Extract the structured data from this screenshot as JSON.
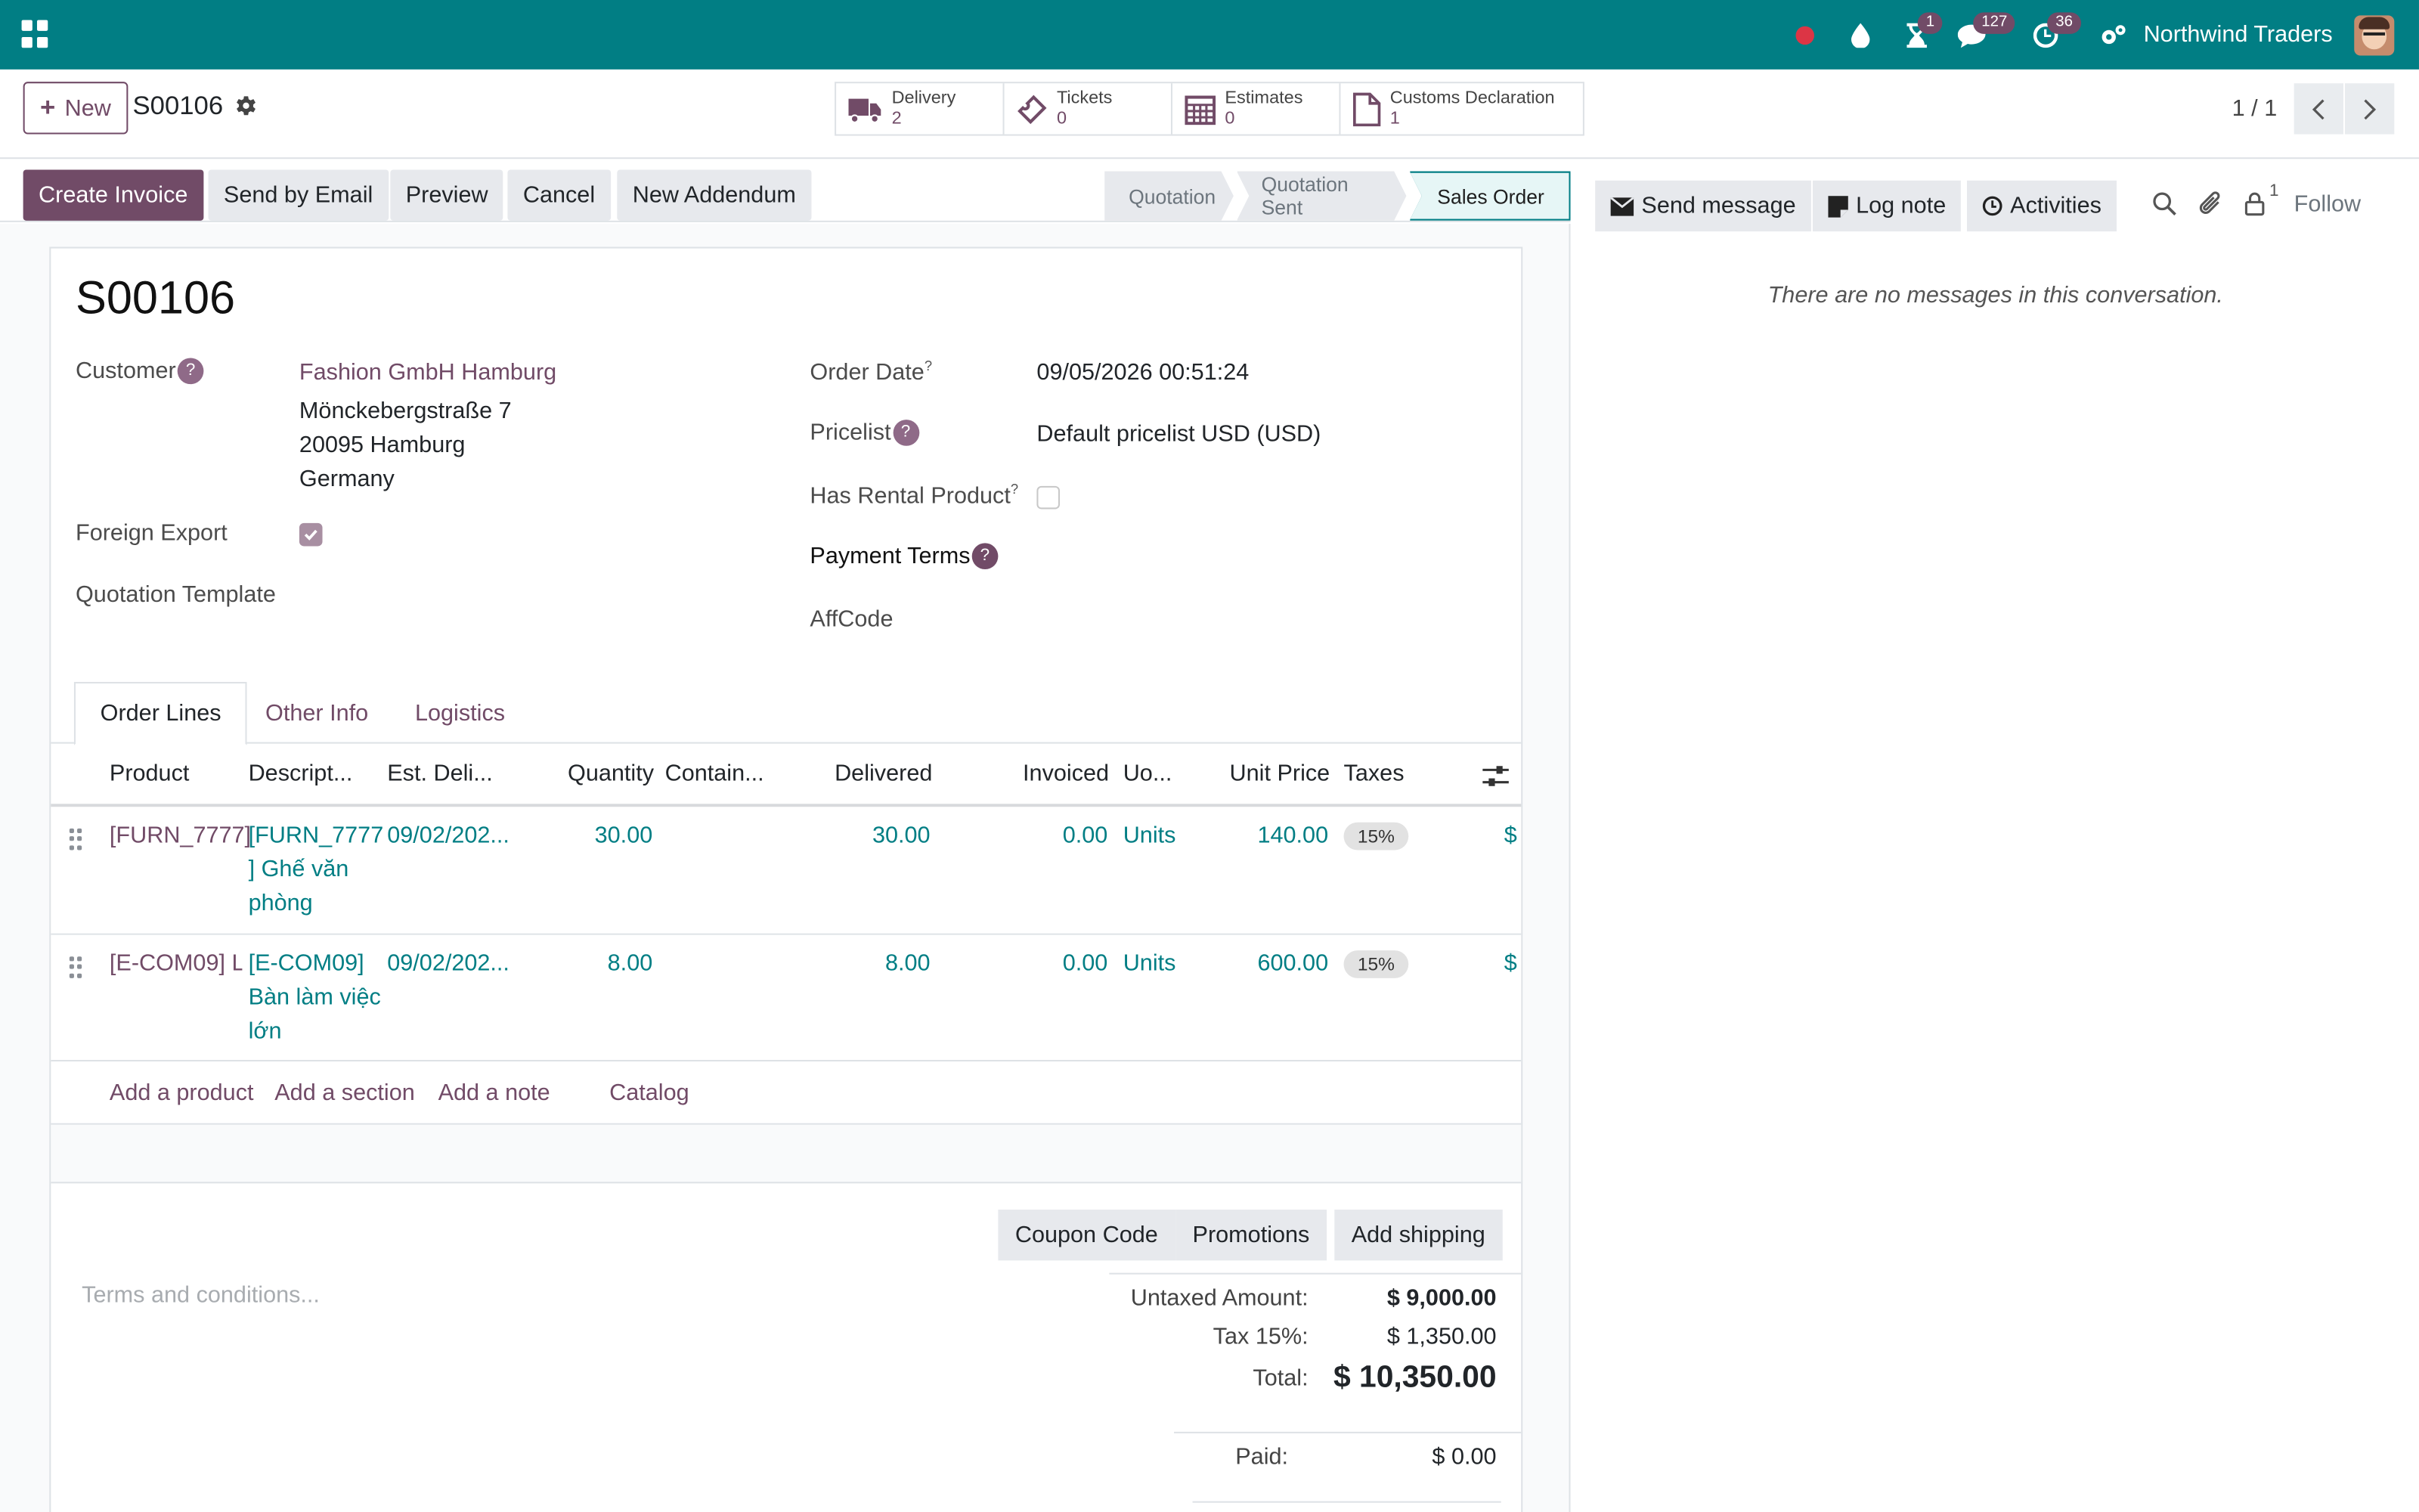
{
  "navbar": {
    "company": "Northwind Traders",
    "badges": {
      "activities": "1",
      "messages": "127",
      "clock": "36"
    },
    "colors": {
      "bar": "#017e84",
      "accent": "#714b67"
    }
  },
  "control_panel": {
    "new_label": "New",
    "record_name": "S00106",
    "pager": "1 / 1",
    "smart_buttons": [
      {
        "label": "Delivery",
        "value": "2",
        "icon": "truck-icon"
      },
      {
        "label": "Tickets",
        "value": "0",
        "icon": "ticket-icon"
      },
      {
        "label": "Estimates",
        "value": "0",
        "icon": "calendar-grid-icon"
      },
      {
        "label": "Customs Declaration",
        "value": "1",
        "icon": "document-icon"
      }
    ]
  },
  "statusbar": {
    "actions": [
      "Create Invoice",
      "Send by Email",
      "Preview",
      "Cancel",
      "New Addendum"
    ],
    "stages": [
      "Quotation",
      "Quotation Sent",
      "Sales Order"
    ],
    "active_stage": "Sales Order"
  },
  "form": {
    "title": "S00106",
    "labels": {
      "customer": "Customer",
      "foreign_export": "Foreign Export",
      "quotation_template": "Quotation Template",
      "order_date": "Order Date",
      "pricelist": "Pricelist",
      "has_rental": "Has Rental Product",
      "payment_terms": "Payment Terms",
      "affcode": "AffCode"
    },
    "customer": {
      "name": "Fashion GmbH Hamburg",
      "street": "Mönckebergstraße 7",
      "city": "20095 Hamburg",
      "country": "Germany"
    },
    "foreign_export": true,
    "order_date": "09/05/2026 00:51:24",
    "pricelist": "Default pricelist USD (USD)",
    "has_rental_product": false
  },
  "tabs": [
    "Order Lines",
    "Other Info",
    "Logistics"
  ],
  "order_lines": {
    "columns": [
      "Product",
      "Descript...",
      "Est. Deli...",
      "Quantity",
      "Contain...",
      "Delivered",
      "Invoiced",
      "Uo...",
      "Unit Price",
      "Taxes"
    ],
    "rows": [
      {
        "product": "[FURN_7777]",
        "description": "[FURN_7777 ] Ghế văn phòng",
        "est_delivery": "09/02/202...",
        "quantity": "30.00",
        "delivered": "30.00",
        "invoiced": "0.00",
        "uom": "Units",
        "unit_price": "140.00",
        "taxes": "15%",
        "subtotal": "$"
      },
      {
        "product": "[E-COM09] La",
        "description": "[E-COM09] Bàn làm việc lớn",
        "est_delivery": "09/02/202...",
        "quantity": "8.00",
        "delivered": "8.00",
        "invoiced": "0.00",
        "uom": "Units",
        "unit_price": "600.00",
        "taxes": "15%",
        "subtotal": "$"
      }
    ],
    "add_links": [
      "Add a product",
      "Add a section",
      "Add a note",
      "Catalog"
    ]
  },
  "footer": {
    "promo_buttons": [
      "Coupon Code",
      "Promotions",
      "Add shipping"
    ],
    "terms_placeholder": "Terms and conditions...",
    "totals": {
      "untaxed_label": "Untaxed Amount:",
      "untaxed": "$ 9,000.00",
      "tax_label": "Tax 15%:",
      "tax": "$ 1,350.00",
      "total_label": "Total:",
      "total": "$ 10,350.00",
      "paid_label": "Paid:",
      "paid": "$ 0.00"
    }
  },
  "chatter": {
    "send_message": "Send message",
    "log_note": "Log note",
    "activities": "Activities",
    "followers_count": "1",
    "follow": "Follow",
    "empty": "There are no messages in this conversation."
  }
}
